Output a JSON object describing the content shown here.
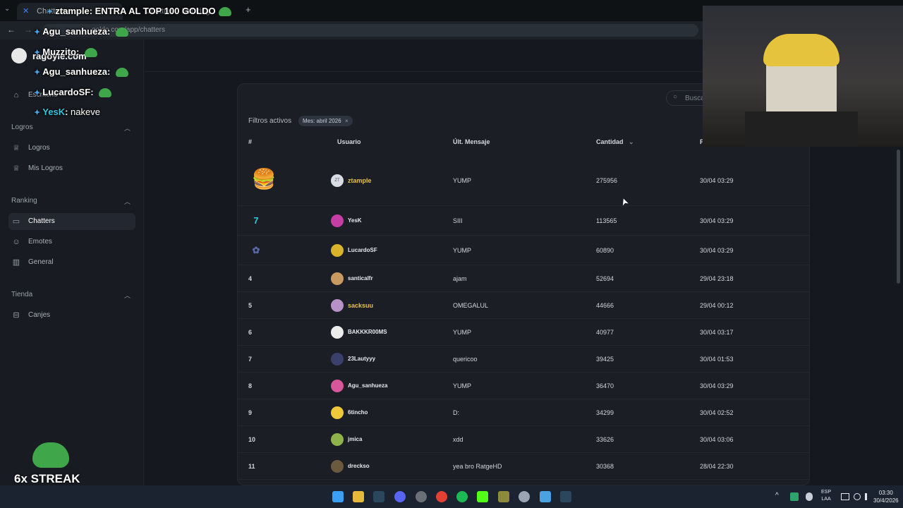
{
  "browser": {
    "tab_title": "Chatters",
    "tab2_title": "Chatters - Ranking",
    "new_tab": "+",
    "url": "goldo.com/app/chatters"
  },
  "sidebar": {
    "brand": "ragoyle.com",
    "escritorio": "Escritorio",
    "sections": [
      {
        "title": "Logros",
        "items": [
          "Logros",
          "Mis Logros"
        ]
      },
      {
        "title": "Ranking",
        "items": [
          "Chatters",
          "Emotes",
          "General"
        ]
      },
      {
        "title": "Tienda",
        "items": [
          "Canjes"
        ]
      }
    ]
  },
  "main": {
    "search_placeholder": "Buscar",
    "filters_label": "Filtros activos",
    "filter_chip": "Mes: abril 2026",
    "filter_chip_close": "×",
    "columns": {
      "rank": "#",
      "user": "Usuario",
      "last": "Últ. Mensaje",
      "count": "Cantidad",
      "date": "F"
    },
    "sort_icon": "⌄",
    "rows": [
      {
        "rank": "",
        "user": "ztample",
        "last": "YUMP",
        "count": "275956",
        "date": "30/04 03:29"
      },
      {
        "rank": "",
        "user": "YesK",
        "last": "SIII",
        "count": "113565",
        "date": "30/04 03:29"
      },
      {
        "rank": "",
        "user": "LucardoSF",
        "last": "YUMP",
        "count": "60890",
        "date": "30/04 03:29"
      },
      {
        "rank": "4",
        "user": "santicalfr",
        "last": "ajam",
        "count": "52694",
        "date": "29/04 23:18"
      },
      {
        "rank": "5",
        "user": "sacksuu",
        "last": "OMEGALUL",
        "count": "44666",
        "date": "29/04 00:12"
      },
      {
        "rank": "6",
        "user": "BAKKKR00MS",
        "last": "YUMP",
        "count": "40977",
        "date": "30/04 03:17"
      },
      {
        "rank": "7",
        "user": "23Lautyyy",
        "last": "quericoo",
        "count": "39425",
        "date": "30/04 01:53"
      },
      {
        "rank": "8",
        "user": "Agu_sanhueza",
        "last": "YUMP",
        "count": "36470",
        "date": "30/04 03:29"
      },
      {
        "rank": "9",
        "user": "6tincho",
        "last": "D:",
        "count": "34299",
        "date": "30/04 02:52"
      },
      {
        "rank": "10",
        "user": "jmica",
        "last": "xdd",
        "count": "33626",
        "date": "30/04 03:06"
      },
      {
        "rank": "11",
        "user": "drecksо",
        "last": "yea bro RatgeHD",
        "count": "30368",
        "date": "28/04 22:30"
      }
    ]
  },
  "overlay": {
    "chat": [
      {
        "user": "ztample",
        "msg": "ENTRA AL TOP 100 GOLDO"
      },
      {
        "user": "Agu_sanhueza",
        "msg": ""
      },
      {
        "user": "Muzzito",
        "msg": ""
      },
      {
        "user": "Agu_sanhueza",
        "msg": ""
      },
      {
        "user": "LucardoSF",
        "msg": ""
      },
      {
        "user": "YesK",
        "msg": "nakeve"
      }
    ],
    "streak": "6x STREAK"
  },
  "taskbar": {
    "lang_top": "ESP",
    "lang_bottom": "LAA",
    "time": "03:30",
    "date": "30/4/2026",
    "tray_up": "^"
  },
  "colors": {
    "gold": "#e7c14b",
    "card": "#1b1f25",
    "bg": "#15191f"
  }
}
